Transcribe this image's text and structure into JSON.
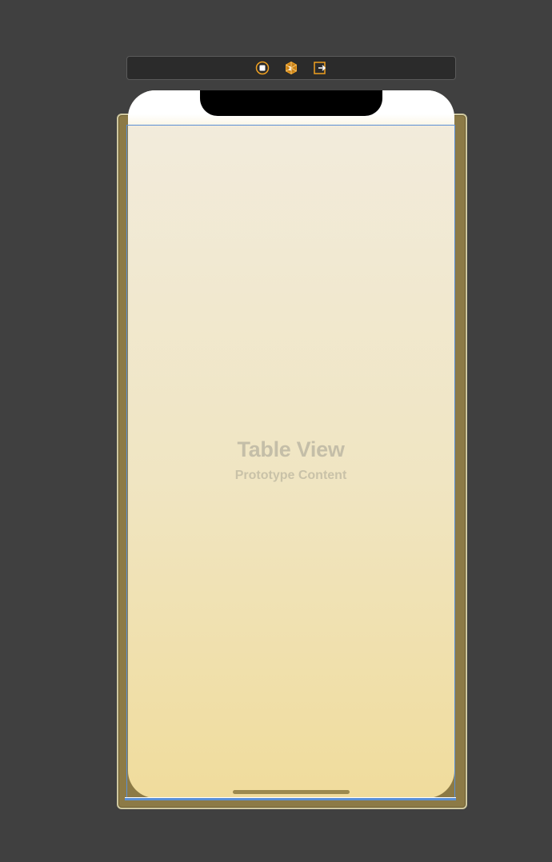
{
  "scene_dock": {
    "icons": [
      {
        "name": "view-controller-icon",
        "color": "#f0a020"
      },
      {
        "name": "first-responder-icon",
        "color": "#f0a020"
      },
      {
        "name": "exit-icon",
        "color": "#f0a020"
      }
    ]
  },
  "table_view": {
    "title": "Table View",
    "subtitle": "Prototype Content"
  },
  "colors": {
    "canvas": "#404040",
    "accent": "#f0a020",
    "selection": "#5a8fd6",
    "screen_top": "#f2ecde",
    "screen_bottom": "#f0dc9c"
  }
}
